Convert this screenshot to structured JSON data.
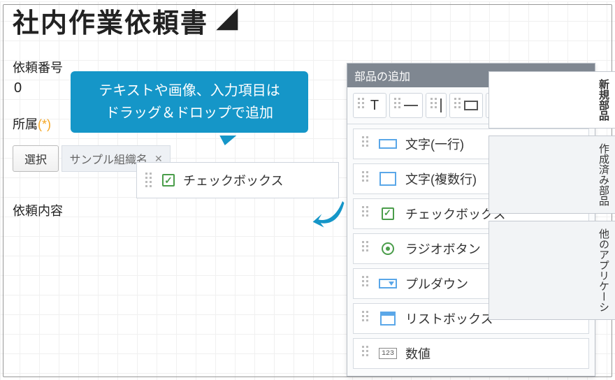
{
  "page": {
    "title": "社内作業依頼書"
  },
  "fields": {
    "request_number": {
      "label": "依頼番号",
      "value": "0"
    },
    "department": {
      "label": "所属",
      "required_mark": "(*)",
      "select_button": "選択",
      "tag_value": "サンプル組織名"
    },
    "request_content": {
      "label": "依頼内容"
    }
  },
  "dropped": {
    "checkbox_label": "チェックボックス"
  },
  "tooltip": {
    "line1": "テキストや画像、入力項目は",
    "line2": "ドラッグ＆ドロップで追加"
  },
  "palette": {
    "title": "部品の追加",
    "toolbar": {
      "text": "T",
      "num_preview": "123"
    },
    "items": [
      {
        "key": "text-single",
        "label": "文字(一行)"
      },
      {
        "key": "text-multi",
        "label": "文字(複数行)"
      },
      {
        "key": "checkbox",
        "label": "チェックボックス"
      },
      {
        "key": "radio",
        "label": "ラジオボタン"
      },
      {
        "key": "pulldown",
        "label": "プルダウン"
      },
      {
        "key": "listbox",
        "label": "リストボックス"
      },
      {
        "key": "number",
        "label": "数値"
      }
    ]
  },
  "side_tabs": {
    "new": "新規部品",
    "created": "作成済み部品",
    "other_apps": "他のアプリケーシ"
  }
}
